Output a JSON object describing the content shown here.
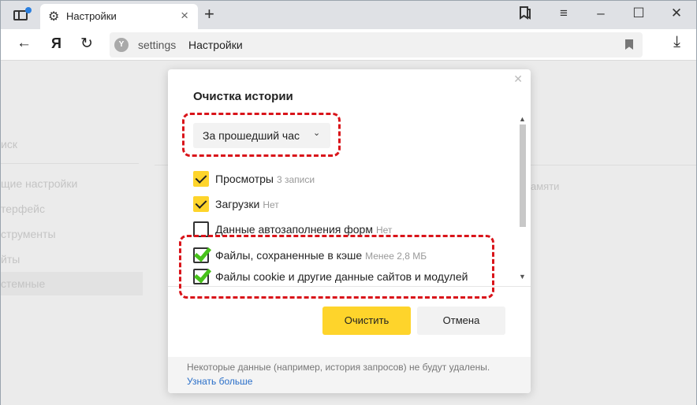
{
  "browser": {
    "tab_title": "Настройки",
    "url_host": "settings",
    "url_title": "Настройки",
    "ya_label": "Я"
  },
  "settings_page": {
    "search_fragment": "иск",
    "sidebar": [
      {
        "label": "щие настройки"
      },
      {
        "label": "терфейс"
      },
      {
        "label": "струменты"
      },
      {
        "label": "йты"
      },
      {
        "label": "стемные"
      }
    ],
    "right_fragment": "амяти"
  },
  "dialog": {
    "title": "Очистка истории",
    "period": {
      "selected": "За прошедший час"
    },
    "options": [
      {
        "label": "Просмотры",
        "meta": "3 записи",
        "state": "checked"
      },
      {
        "label": "Загрузки",
        "meta": "Нет",
        "state": "checked"
      },
      {
        "label": "Данные автозаполнения форм",
        "meta": "Нет",
        "state": "unchecked"
      },
      {
        "label": "Файлы, сохраненные в кэше",
        "meta": "Менее 2,8 МБ",
        "state": "checked-green"
      },
      {
        "label": "Файлы cookie и другие данные сайтов и модулей",
        "meta": "",
        "state": "checked-green"
      }
    ],
    "clear_button": "Очистить",
    "cancel_button": "Отмена",
    "footer_note": "Некоторые данные (например, история запросов) не будут удалены.",
    "footer_link": "Узнать больше"
  },
  "colors": {
    "accent_yellow": "#fed42b",
    "highlight_red": "#d9141a",
    "check_green": "#48c21a",
    "link_blue": "#2a6fc9"
  }
}
